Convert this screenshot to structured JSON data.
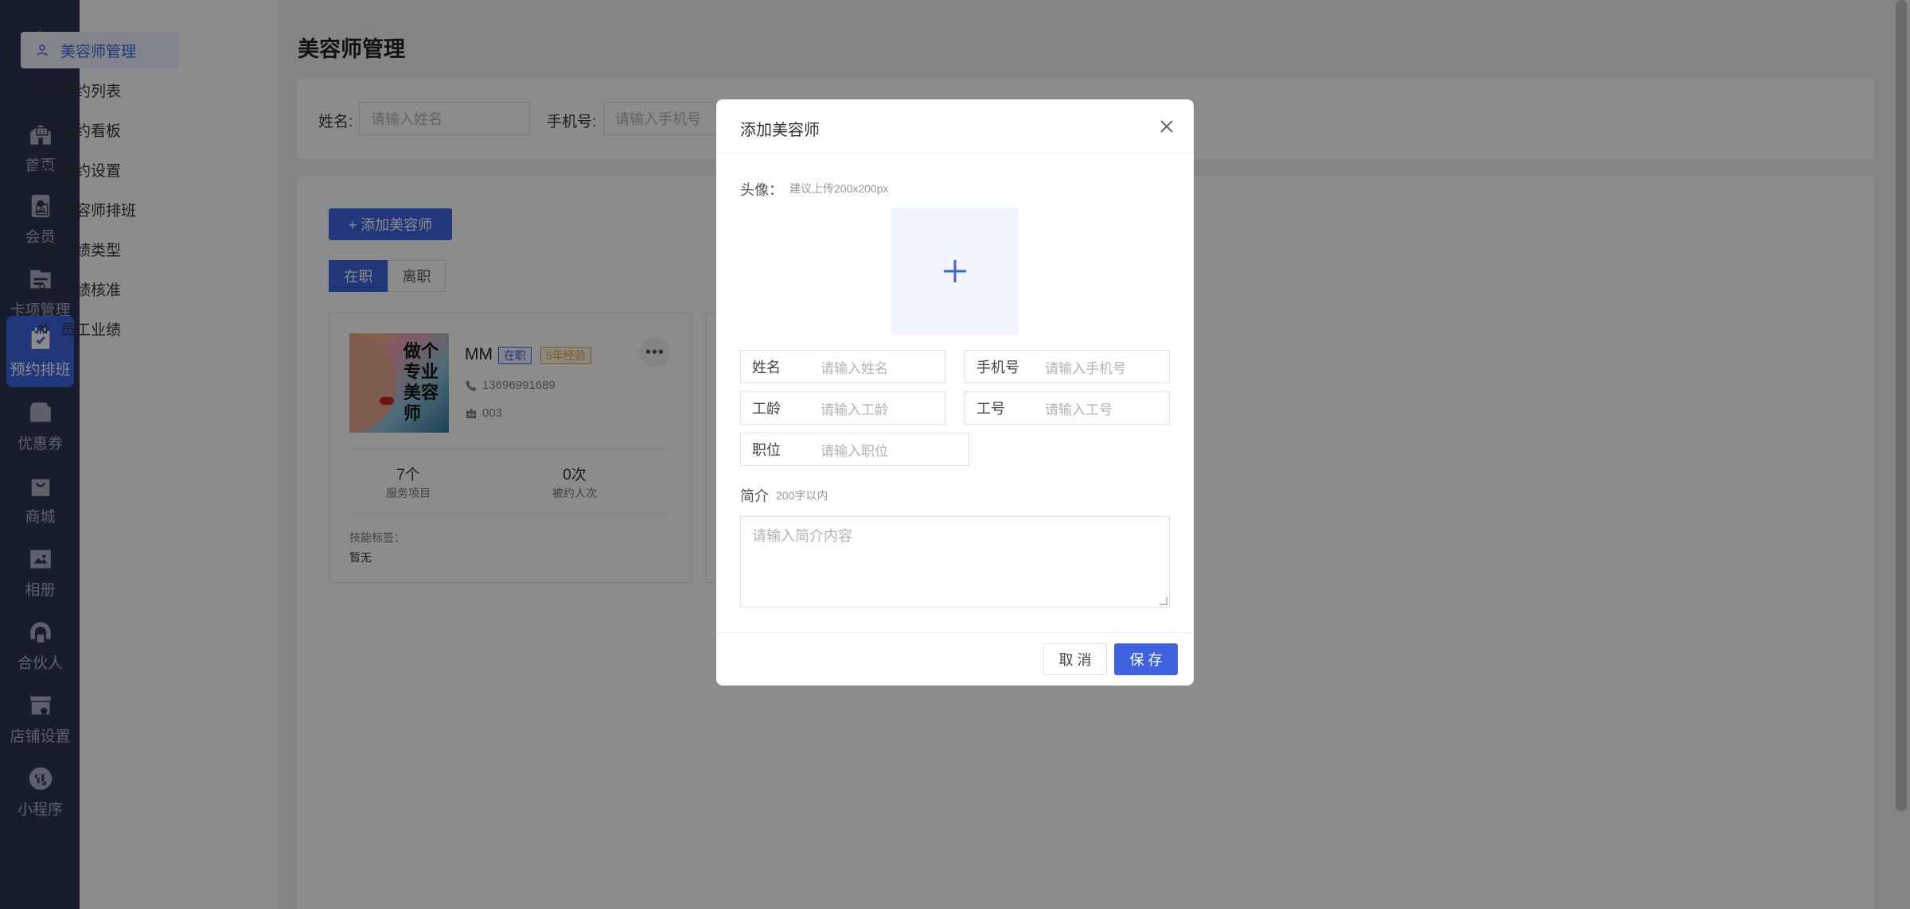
{
  "nav": {
    "items": [
      {
        "label": "首页",
        "icon": "home-icon"
      },
      {
        "label": "会员",
        "icon": "member-icon"
      },
      {
        "label": "卡项管理",
        "icon": "card-icon"
      },
      {
        "label": "预约排班",
        "icon": "calendar-icon"
      },
      {
        "label": "优惠券",
        "icon": "wallet-icon"
      },
      {
        "label": "商城",
        "icon": "shop-bag-icon"
      },
      {
        "label": "相册",
        "icon": "album-icon"
      },
      {
        "label": "合伙人",
        "icon": "partner-icon"
      },
      {
        "label": "店铺设置",
        "icon": "store-settings-icon"
      },
      {
        "label": "小程序",
        "icon": "mini-program-icon"
      }
    ],
    "active": "预约排班"
  },
  "subnav": {
    "items": [
      {
        "label": "美容师管理",
        "icon": "user-icon"
      },
      {
        "label": "预约列表",
        "icon": "list-icon"
      },
      {
        "label": "预约看板",
        "icon": "board-icon"
      },
      {
        "label": "预约设置",
        "icon": "settings-icon"
      },
      {
        "label": "美容师排班",
        "icon": "schedule-icon"
      },
      {
        "label": "业绩类型",
        "icon": "type-icon"
      },
      {
        "label": "业绩核准",
        "icon": "approve-icon"
      },
      {
        "label": "员工业绩",
        "icon": "chart-icon"
      }
    ],
    "active": "美容师管理"
  },
  "page": {
    "title": "美容师管理"
  },
  "search": {
    "name_label": "姓名:",
    "name_placeholder": "请输入姓名",
    "phone_label": "手机号:",
    "phone_placeholder": "请输入手机号"
  },
  "toolbar": {
    "add_label": "+ 添加美容师"
  },
  "tabs": [
    {
      "label": "在职",
      "active": true
    },
    {
      "label": "离职",
      "active": false
    }
  ],
  "card": {
    "name": "MM",
    "status_badge": "在职",
    "experience_badge": "5年经验",
    "phone": "13696991689",
    "job_number": "003",
    "services_value": "7个",
    "services_label": "服务项目",
    "booked_value": "0次",
    "booked_label": "被约人次",
    "skills_label": "技能标签：",
    "skills_value": "暂无",
    "avatar_text": "做个专业美容师"
  },
  "modal": {
    "title": "添加美容师",
    "avatar_label": "头像：",
    "avatar_hint": "建议上传200x200px",
    "fields": {
      "name": {
        "label": "姓名",
        "placeholder": "请输入姓名"
      },
      "phone": {
        "label": "手机号",
        "placeholder": "请输入手机号"
      },
      "seniority": {
        "label": "工龄",
        "placeholder": "请输入工龄"
      },
      "job_number": {
        "label": "工号",
        "placeholder": "请输入工号"
      },
      "position": {
        "label": "职位",
        "placeholder": "请输入职位"
      }
    },
    "intro_label": "简介",
    "intro_hint": "200字以内",
    "intro_placeholder": "请输入简介内容",
    "cancel_label": "取 消",
    "save_label": "保 存"
  },
  "colors": {
    "primary": "#3f63e0",
    "nav_bg": "#2a3550",
    "badge_orange": "#e6a23c"
  }
}
